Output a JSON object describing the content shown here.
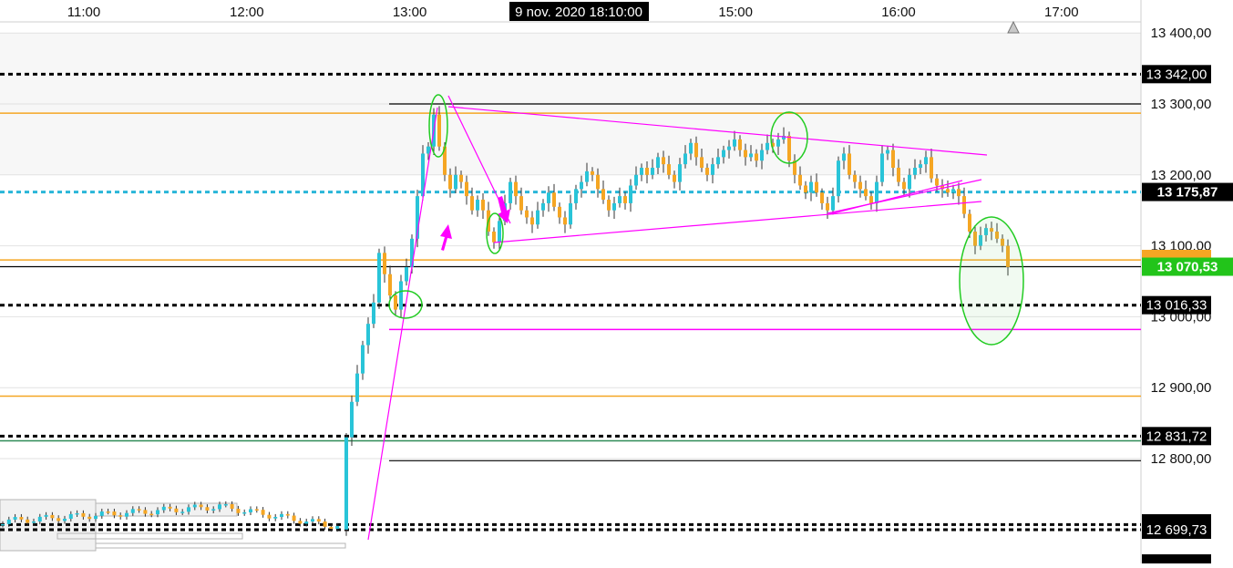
{
  "chart_data": {
    "type": "candlestick",
    "crosshair_label": "9 nov. 2020 18:10:00",
    "x_ticks": [
      "11:00",
      "12:00",
      "13:00",
      "15:00",
      "16:00",
      "17:00"
    ],
    "y_ticks": [
      "13 400,00",
      "13 300,00",
      "13 200,00",
      "13 100,00",
      "13 000,00",
      "12 900,00",
      "12 800,00"
    ],
    "ylim": [
      12600,
      13450
    ],
    "price_labels": [
      {
        "value": 13342.0,
        "text": "13 342,00",
        "style": "black"
      },
      {
        "value": 13175.87,
        "text": "13 175,87",
        "style": "black-bold"
      },
      {
        "value": 13070.53,
        "text": "13 070,53",
        "style": "green"
      },
      {
        "value": 13016.33,
        "text": "13 016,33",
        "style": "black"
      },
      {
        "value": 12831.72,
        "text": "12 831,72",
        "style": "black"
      },
      {
        "value": 12699.73,
        "text": "12 699,73",
        "style": "black"
      }
    ],
    "horizontal_lines": [
      {
        "value": 13342.0,
        "color": "#000000",
        "style": "dotted"
      },
      {
        "value": 13300.0,
        "color": "#000000",
        "style": "solid"
      },
      {
        "value": 13287.0,
        "color": "#f5a623",
        "style": "solid"
      },
      {
        "value": 13175.87,
        "color": "#29b6d8",
        "style": "dotted"
      },
      {
        "value": 13080.0,
        "color": "#f5a623",
        "style": "solid"
      },
      {
        "value": 13070.53,
        "color": "#000000",
        "style": "solid"
      },
      {
        "value": 13016.33,
        "color": "#000000",
        "style": "dotted"
      },
      {
        "value": 12982.0,
        "color": "#ff00ff",
        "style": "solid"
      },
      {
        "value": 12888.0,
        "color": "#f5a623",
        "style": "solid"
      },
      {
        "value": 12831.72,
        "color": "#000000",
        "style": "dotted"
      },
      {
        "value": 12825.0,
        "color": "#2e8b57",
        "style": "solid"
      },
      {
        "value": 12797.0,
        "color": "#000000",
        "style": "solid"
      },
      {
        "value": 12707.0,
        "color": "#000000",
        "style": "dotted"
      },
      {
        "value": 12699.73,
        "color": "#000000",
        "style": "dotted"
      }
    ],
    "colors": {
      "up": "#29c4d8",
      "down": "#f5a623",
      "accent_green": "#22cc22",
      "trend": "#ff00ff"
    }
  }
}
